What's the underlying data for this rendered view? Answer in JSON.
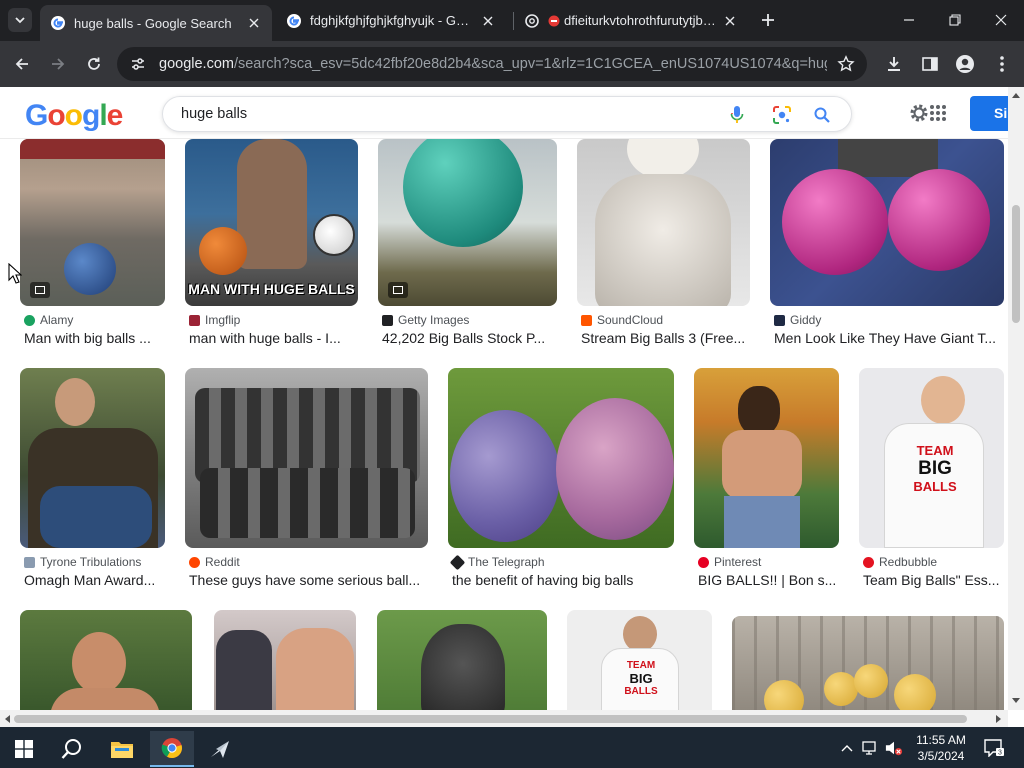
{
  "browser": {
    "tabs": [
      {
        "title": "huge balls - Google Search",
        "active": true
      },
      {
        "title": "fdghjkfghjfghjkfghyujk - Google",
        "active": false
      },
      {
        "title": "dfieiturkvtohrothfurutytjbdjnfjrhyrjdjej",
        "active": false
      }
    ],
    "url_host": "google.com",
    "url_path": "/search?sca_esv=5dc42fbf20e8d2b4&sca_upv=1&rlz=1C1GCEA_enUS1074US1074&q=huge+b..."
  },
  "google": {
    "logo_letters": [
      {
        "ch": "G",
        "color": "#4285F4"
      },
      {
        "ch": "o",
        "color": "#EA4335"
      },
      {
        "ch": "o",
        "color": "#FBBC05"
      },
      {
        "ch": "g",
        "color": "#4285F4"
      },
      {
        "ch": "l",
        "color": "#34A853"
      },
      {
        "ch": "e",
        "color": "#EA4335"
      }
    ],
    "query": "huge balls",
    "signin_label": "Si"
  },
  "results": [
    {
      "source": "Alamy",
      "caption": "Man with big balls ...",
      "src_color": "#1aa260"
    },
    {
      "source": "Imgflip",
      "caption": "man with huge balls - I...",
      "src_color": "#9b2335",
      "overlay": "MAN WITH HUGE BALLS"
    },
    {
      "source": "Getty Images",
      "caption": "42,202 Big Balls Stock P...",
      "src_color": "#202124"
    },
    {
      "source": "SoundCloud",
      "caption": "Stream Big Balls 3 (Free...",
      "src_color": "#ff5500"
    },
    {
      "source": "Giddy",
      "caption": "Men Look Like They Have Giant T...",
      "src_color": "#1f2a44"
    },
    {
      "source": "Tyrone Tribulations",
      "caption": "Omagh Man Award...",
      "src_color": "#8a9bb0"
    },
    {
      "source": "Reddit",
      "caption": "These guys have some serious ball...",
      "src_color": "#ff4500"
    },
    {
      "source": "The Telegraph",
      "caption": "the benefit of having big balls",
      "src_color": "#202124"
    },
    {
      "source": "Pinterest",
      "caption": "BIG BALLS!! | Bon s...",
      "src_color": "#e60023"
    },
    {
      "source": "Redbubble",
      "caption": "Team Big Balls\" Ess...",
      "src_color": "#e41321",
      "shirt": [
        "TEAM",
        "BIG",
        "BALLS"
      ]
    },
    {
      "source": "",
      "caption": ""
    },
    {
      "source": "",
      "caption": ""
    },
    {
      "source": "",
      "caption": ""
    },
    {
      "source": "",
      "caption": "",
      "shirt": [
        "TEAM",
        "BIG",
        "BALLS"
      ]
    },
    {
      "source": "",
      "caption": ""
    }
  ],
  "taskbar": {
    "time": "11:55 AM",
    "date": "3/5/2024"
  }
}
